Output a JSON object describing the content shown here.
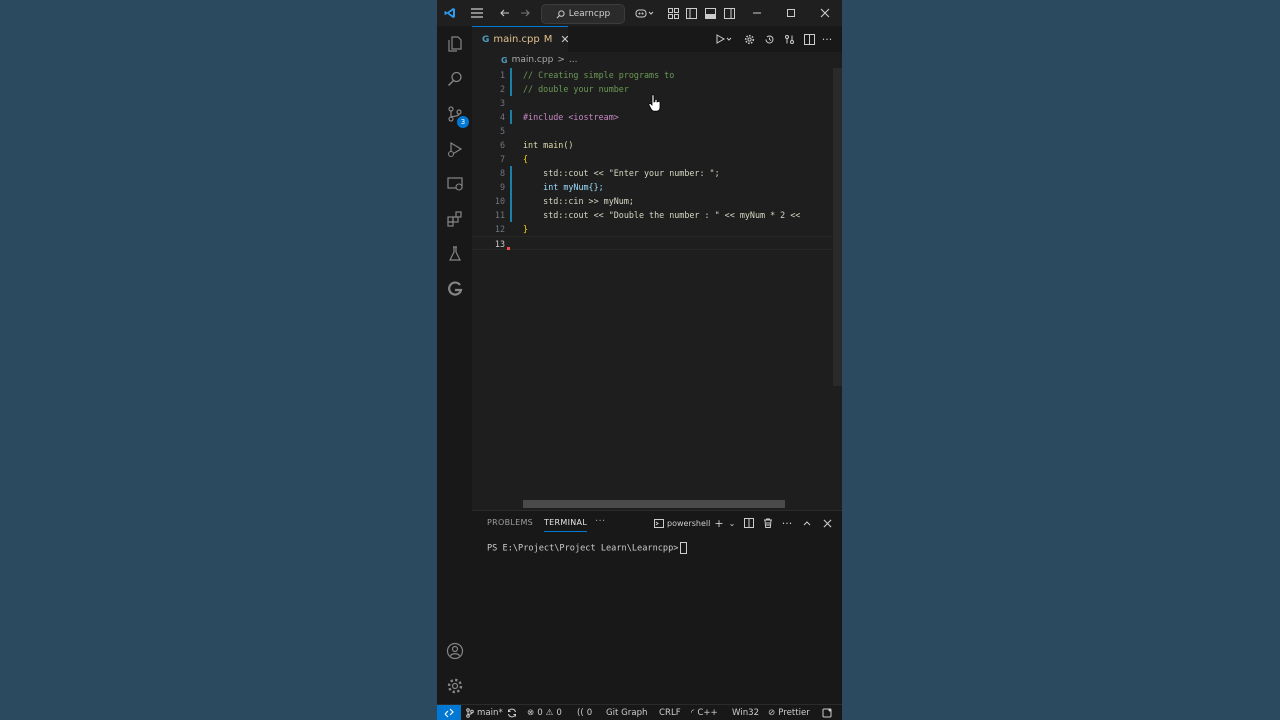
{
  "titlebar": {
    "search_text": "Learncpp"
  },
  "activity": {
    "source_control_badge": "3"
  },
  "tab": {
    "filename": "main.cpp",
    "status": "M"
  },
  "breadcrumb": {
    "file": "main.cpp",
    "sep": ">",
    "more": "..."
  },
  "editor": {
    "lines": [
      {
        "n": "1",
        "text": "// Creating simple programs to"
      },
      {
        "n": "2",
        "text": "// double your number"
      },
      {
        "n": "3",
        "text": ""
      },
      {
        "n": "4",
        "text": "#include <iostream>"
      },
      {
        "n": "5",
        "text": ""
      },
      {
        "n": "6",
        "text": "int main()"
      },
      {
        "n": "7",
        "text": "{"
      },
      {
        "n": "8",
        "text": "    std::cout << \"Enter your number: \";"
      },
      {
        "n": "9",
        "text": "    int myNum{};"
      },
      {
        "n": "10",
        "text": "    std::cin >> myNum;"
      },
      {
        "n": "11",
        "text": "    std::cout << \"Double the number : \" << myNum * 2 <<"
      },
      {
        "n": "12",
        "text": "}"
      },
      {
        "n": "13",
        "text": ""
      }
    ]
  },
  "panel": {
    "tab_problems": "PROBLEMS",
    "tab_terminal": "TERMINAL",
    "more": "···",
    "shell": "powershell",
    "prompt": "PS E:\\Project\\Project Learn\\Learncpp>"
  },
  "status": {
    "branch": "main*",
    "errors": "0",
    "warnings": "0",
    "ports": "0",
    "git_graph": "Git Graph",
    "eol": "CRLF",
    "language": "C++",
    "platform": "Win32",
    "formatter": "Prettier"
  },
  "colors": {
    "accent": "#0078d4",
    "background": "#2c4a5f",
    "editor_bg": "#1e1e1e",
    "modified": "#e2c08d"
  }
}
